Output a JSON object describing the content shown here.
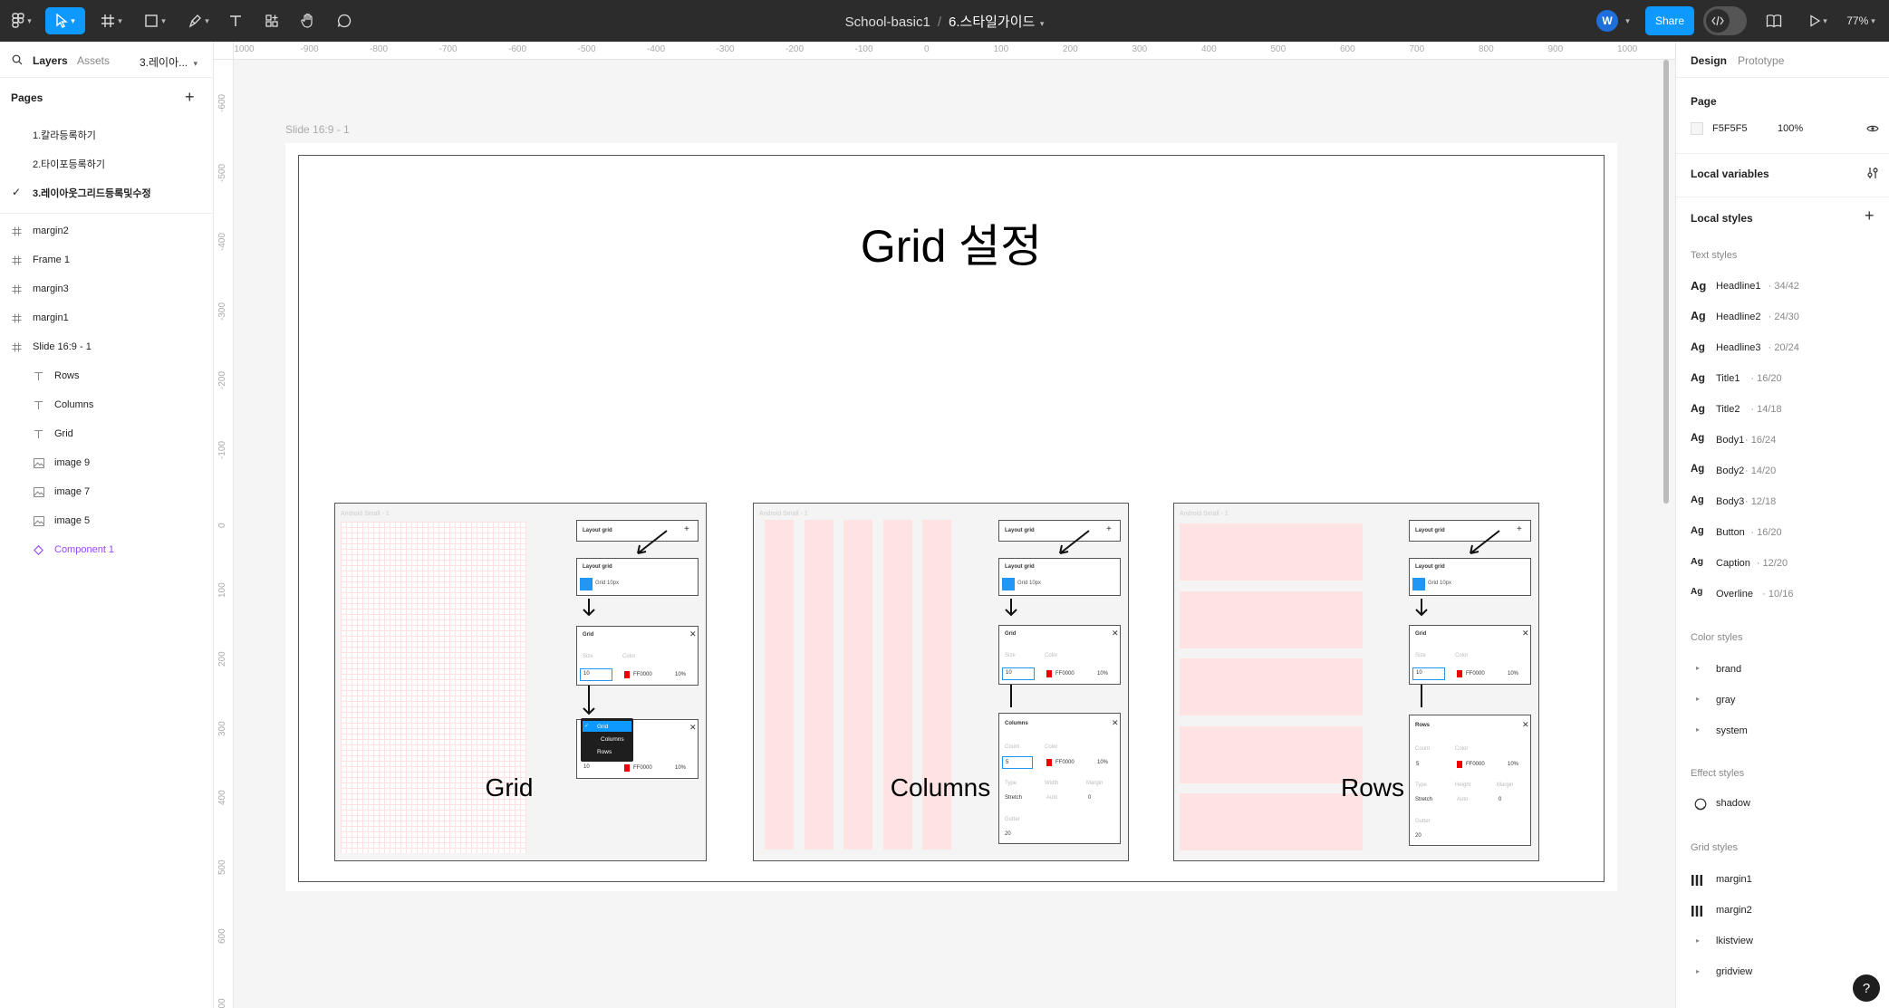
{
  "topbar": {
    "file_name": "School-basic1",
    "separator": "/",
    "page_name": "6.스타일가이드",
    "user_initial": "W",
    "share_label": "Share",
    "zoom": "77%",
    "tools": [
      "figma-menu-icon",
      "move-tool-icon",
      "frame-tool-icon",
      "shape-tool-icon",
      "pen-tool-icon",
      "text-tool-icon",
      "resources-icon",
      "hand-tool-icon",
      "comment-tool-icon"
    ]
  },
  "left": {
    "tabs": {
      "layers": "Layers",
      "assets": "Assets",
      "current_page": "3.레이아..."
    },
    "pages_header": "Pages",
    "pages": [
      {
        "label": "1.칼라등록하기",
        "active": false
      },
      {
        "label": "2.타이포등록하기",
        "active": false
      },
      {
        "label": "3.레이아웃그리드등록및수정",
        "active": true
      }
    ],
    "layers": [
      {
        "label": "margin2",
        "icon": "frame-icon",
        "indent": 0
      },
      {
        "label": "Frame 1",
        "icon": "frame-icon",
        "indent": 0
      },
      {
        "label": "margin3",
        "icon": "frame-icon",
        "indent": 0
      },
      {
        "label": "margin1",
        "icon": "frame-icon",
        "indent": 0
      },
      {
        "label": "Slide 16:9 - 1",
        "icon": "frame-icon",
        "indent": 0
      },
      {
        "label": "Rows",
        "icon": "text-icon",
        "indent": 1
      },
      {
        "label": "Columns",
        "icon": "text-icon",
        "indent": 1
      },
      {
        "label": "Grid",
        "icon": "text-icon",
        "indent": 1
      },
      {
        "label": "image 9",
        "icon": "image-icon",
        "indent": 1
      },
      {
        "label": "image 7",
        "icon": "image-icon",
        "indent": 1
      },
      {
        "label": "image 5",
        "icon": "image-icon",
        "indent": 1
      },
      {
        "label": "Component 1",
        "icon": "component-icon",
        "indent": 1
      }
    ]
  },
  "canvas": {
    "ruler_h": [
      "-1000",
      "-900",
      "-800",
      "-700",
      "-600",
      "-500",
      "-400",
      "-300",
      "-200",
      "-100",
      "0",
      "100",
      "200",
      "300",
      "400",
      "500",
      "600",
      "700",
      "800",
      "900",
      "1000"
    ],
    "ruler_v": [
      "-600",
      "-500",
      "-400",
      "-300",
      "-200",
      "-100",
      "0",
      "100",
      "200",
      "300",
      "400",
      "500",
      "600",
      "700"
    ],
    "frame_label": "Slide 16:9 - 1",
    "slide_title": "Grid 설정",
    "captions": [
      "Grid",
      "Columns",
      "Rows"
    ],
    "mini_frame_label": "Android Small - 1",
    "mini_panel": {
      "layout_grid": "Layout grid",
      "grid_item": "Grid 10px",
      "grid_header": "Grid",
      "columns_header": "Columns",
      "rows_header": "Rows",
      "size": "Size",
      "color": "Color",
      "count": "Count",
      "type": "Type",
      "width": "Width",
      "height": "Height",
      "margin": "Margin",
      "gutter": "Gutter",
      "value_10": "10",
      "value_5": "5",
      "value_0": "0",
      "value_20": "20",
      "color_hex": "FF0000",
      "opacity": "10%",
      "stretch": "Stretch",
      "auto": "Auto",
      "menu_items": [
        "Grid",
        "Columns",
        "Rows"
      ]
    }
  },
  "right": {
    "tabs": {
      "design": "Design",
      "prototype": "Prototype"
    },
    "page_header": "Page",
    "page_color": "F5F5F5",
    "page_opacity": "100%",
    "local_variables": "Local variables",
    "local_styles": "Local styles",
    "text_styles_header": "Text styles",
    "text_styles": [
      {
        "name": "Headline1",
        "spec": "34/42"
      },
      {
        "name": "Headline2",
        "spec": "24/30"
      },
      {
        "name": "Headline3",
        "spec": "20/24"
      },
      {
        "name": "Title1",
        "spec": "16/20"
      },
      {
        "name": "Title2",
        "spec": "14/18"
      },
      {
        "name": "Body1",
        "spec": "16/24"
      },
      {
        "name": "Body2",
        "spec": "14/20"
      },
      {
        "name": "Body3",
        "spec": "12/18"
      },
      {
        "name": "Button",
        "spec": "16/20"
      },
      {
        "name": "Caption",
        "spec": "12/20"
      },
      {
        "name": "Overline",
        "spec": "10/16"
      }
    ],
    "ag": "Ag",
    "color_styles_header": "Color styles",
    "color_styles": [
      "brand",
      "gray",
      "system"
    ],
    "effect_styles_header": "Effect styles",
    "effect_styles": [
      "shadow"
    ],
    "grid_styles_header": "Grid styles",
    "grid_styles": [
      {
        "name": "margin1",
        "icon": "columns-grid-icon"
      },
      {
        "name": "margin2",
        "icon": "columns-grid-icon"
      },
      {
        "name": "lkistview",
        "icon": "caret-right-icon"
      },
      {
        "name": "gridview",
        "icon": "caret-right-icon"
      }
    ],
    "help": "?"
  },
  "colors": {
    "accent": "#0d99ff",
    "grid_fill": "#ffe2e2",
    "topbar": "#2c2c2c",
    "component": "#9747ff"
  }
}
